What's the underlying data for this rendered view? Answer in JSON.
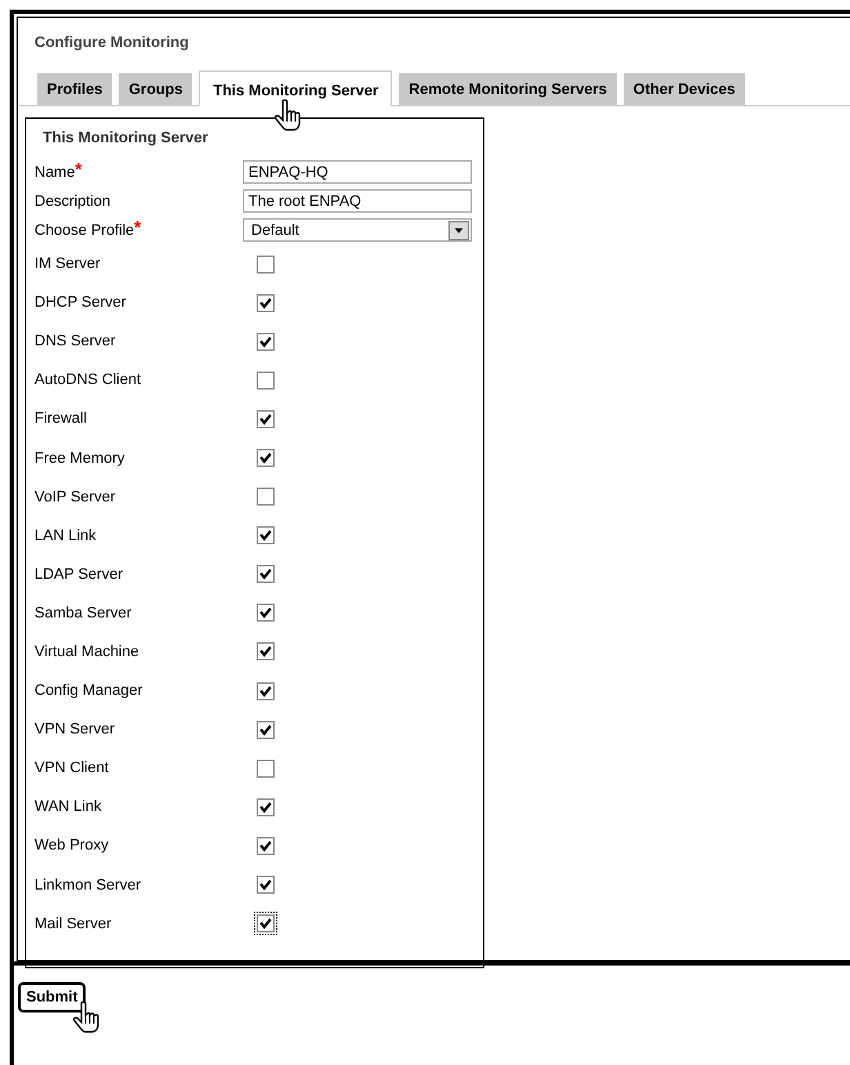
{
  "title": "Configure Monitoring",
  "tabs": [
    {
      "label": "Profiles",
      "selected": false
    },
    {
      "label": "Groups",
      "selected": false
    },
    {
      "label": "This Monitoring Server",
      "selected": true
    },
    {
      "label": "Remote Monitoring Servers",
      "selected": false
    },
    {
      "label": "Other Devices",
      "selected": false
    }
  ],
  "panel": {
    "title": "This Monitoring Server",
    "fields": [
      {
        "kind": "text",
        "label": "Name",
        "required_mark": "*",
        "value": "ENPAQ-HQ"
      },
      {
        "kind": "text",
        "label": "Description",
        "value": "The root ENPAQ"
      },
      {
        "kind": "select",
        "label": "Choose Profile",
        "required_mark": "*",
        "value": "Default"
      },
      {
        "kind": "checkbox",
        "label": "IM Server",
        "checked": false
      },
      {
        "kind": "checkbox",
        "label": "DHCP Server",
        "checked": true
      },
      {
        "kind": "checkbox",
        "label": "DNS Server",
        "checked": true
      },
      {
        "kind": "checkbox",
        "label": "AutoDNS Client",
        "checked": false
      },
      {
        "kind": "checkbox",
        "label": "Firewall",
        "checked": true
      },
      {
        "kind": "checkbox",
        "label": "Free Memory",
        "checked": true
      },
      {
        "kind": "checkbox",
        "label": "VoIP Server",
        "checked": false
      },
      {
        "kind": "checkbox",
        "label": "LAN Link",
        "checked": true
      },
      {
        "kind": "checkbox",
        "label": "LDAP Server",
        "checked": true
      },
      {
        "kind": "checkbox",
        "label": "Samba Server",
        "checked": true
      },
      {
        "kind": "checkbox",
        "label": "Virtual Machine",
        "checked": true
      },
      {
        "kind": "checkbox",
        "label": "Config Manager",
        "checked": true
      },
      {
        "kind": "checkbox",
        "label": "VPN Server",
        "checked": true
      },
      {
        "kind": "checkbox",
        "label": "VPN Client",
        "checked": false
      },
      {
        "kind": "checkbox",
        "label": "WAN Link",
        "checked": true
      },
      {
        "kind": "checkbox",
        "label": "Web Proxy",
        "checked": true
      },
      {
        "kind": "checkbox",
        "label": "Linkmon Server",
        "checked": true
      },
      {
        "kind": "checkbox",
        "label": "Mail Server",
        "checked": true
      }
    ]
  },
  "submit": "Submit"
}
